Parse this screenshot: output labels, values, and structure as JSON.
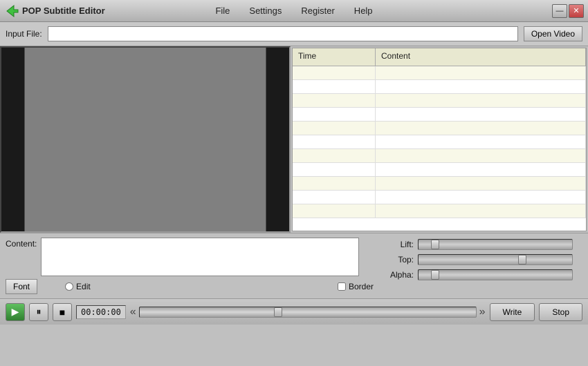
{
  "titlebar": {
    "app_name": "POP  Subtitle Editor",
    "menu": [
      "File",
      "Settings",
      "Register",
      "Help"
    ],
    "minimize_label": "—",
    "close_label": "✕"
  },
  "input_file": {
    "label": "Input File:",
    "placeholder": "",
    "open_video_label": "Open Video"
  },
  "table": {
    "headers": [
      "Time",
      "Content"
    ],
    "rows": []
  },
  "content_section": {
    "label": "Content:",
    "font_label": "Font",
    "edit_label": "Edit",
    "border_label": "Border"
  },
  "sliders": {
    "lift_label": "Lift:",
    "top_label": "Top:",
    "alpha_label": "Alpha:",
    "lift_value": 10,
    "top_value": 70,
    "alpha_value": 10
  },
  "transport": {
    "time": "00:00:00",
    "play_icon": "▶",
    "pause_icon": "⏸",
    "stop_icon": "■",
    "rewind_icon": "«",
    "forward_icon": "»",
    "write_label": "Write",
    "stop_label": "Stop"
  }
}
